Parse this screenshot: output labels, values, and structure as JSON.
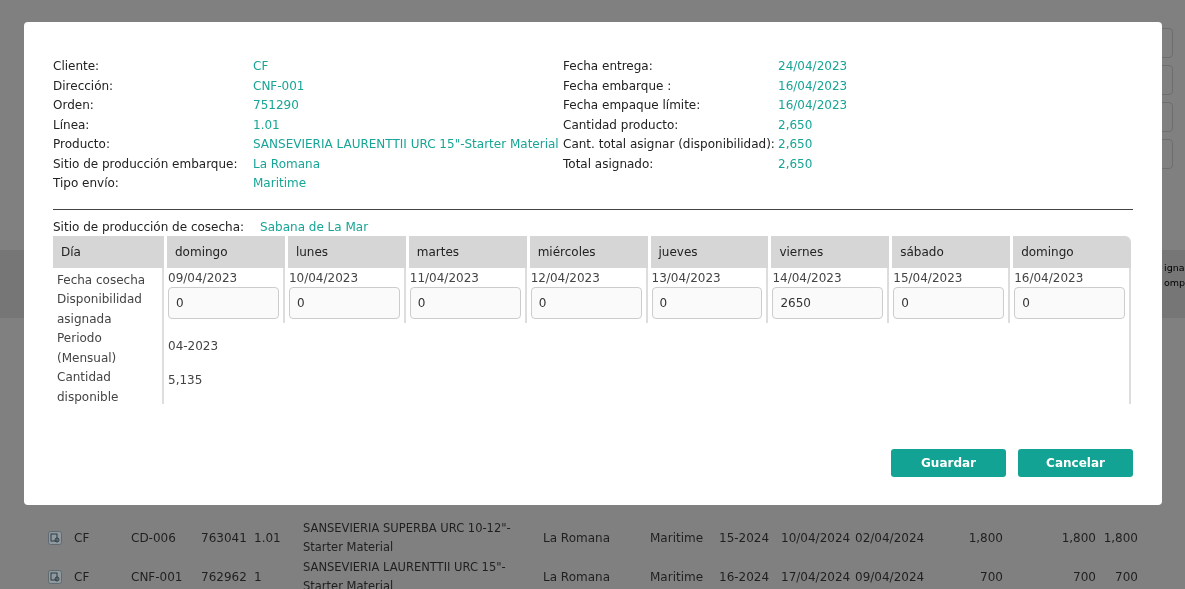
{
  "modal": {
    "info_left": [
      {
        "label": "Cliente:",
        "value": "CF"
      },
      {
        "label": "Dirección:",
        "value": "CNF-001"
      },
      {
        "label": "Orden:",
        "value": "751290"
      },
      {
        "label": "Línea:",
        "value": "1.01"
      },
      {
        "label": "Producto:",
        "value": "SANSEVIERIA LAURENTTII URC 15\"-Starter Material"
      },
      {
        "label": "Sitio de producción embarque:",
        "value": "La Romana"
      },
      {
        "label": "Tipo envío:",
        "value": "Maritime"
      }
    ],
    "info_right": [
      {
        "label": "Fecha entrega:",
        "value": "24/04/2023"
      },
      {
        "label": "Fecha embarque :",
        "value": "16/04/2023"
      },
      {
        "label": "Fecha empaque límite:",
        "value": "16/04/2023"
      },
      {
        "label": "Cantidad producto:",
        "value": "2,650"
      },
      {
        "label": "Cant. total asignar (disponibilidad):",
        "value": "2,650"
      },
      {
        "label": "Total asignado:",
        "value": "2,650"
      }
    ],
    "harvest_site": {
      "label": "Sitio de producción de cosecha:",
      "value": "Sabana de La Mar"
    },
    "table": {
      "columns": [
        "Día",
        "domingo",
        "lunes",
        "martes",
        "miércoles",
        "jueves",
        "viernes",
        "sábado",
        "domingo"
      ],
      "row_labels": [
        "Fecha cosecha",
        "Disponibilidad asignada",
        "Periodo (Mensual)",
        "Cantidad disponible"
      ],
      "dates": [
        "09/04/2023",
        "10/04/2023",
        "11/04/2023",
        "12/04/2023",
        "13/04/2023",
        "14/04/2023",
        "15/04/2023",
        "16/04/2023"
      ],
      "assigned": [
        "0",
        "0",
        "0",
        "0",
        "0",
        "2650",
        "0",
        "0"
      ],
      "period": "04-2023",
      "available": "5,135"
    },
    "buttons": [
      "Guardar",
      "Cancelar"
    ]
  },
  "background": {
    "header_fragments": [
      "igna",
      "omp"
    ],
    "rows": [
      {
        "cells": [
          "CF",
          "CD-006",
          "763041",
          "1.01",
          "SANSEVIERIA SUPERBA URC 10-12\"- Starter Material",
          "La Romana",
          "Maritime",
          "15-2024",
          "10/04/2024",
          "02/04/2024",
          "1,800",
          "1,800",
          "1,800"
        ]
      },
      {
        "cells": [
          "CF",
          "CNF-001",
          "762962",
          "1",
          "SANSEVIERIA LAURENTTII URC 15\"- Starter Material",
          "La Romana",
          "Maritime",
          "16-2024",
          "17/04/2024",
          "09/04/2024",
          "700",
          "700",
          "700"
        ]
      }
    ]
  }
}
